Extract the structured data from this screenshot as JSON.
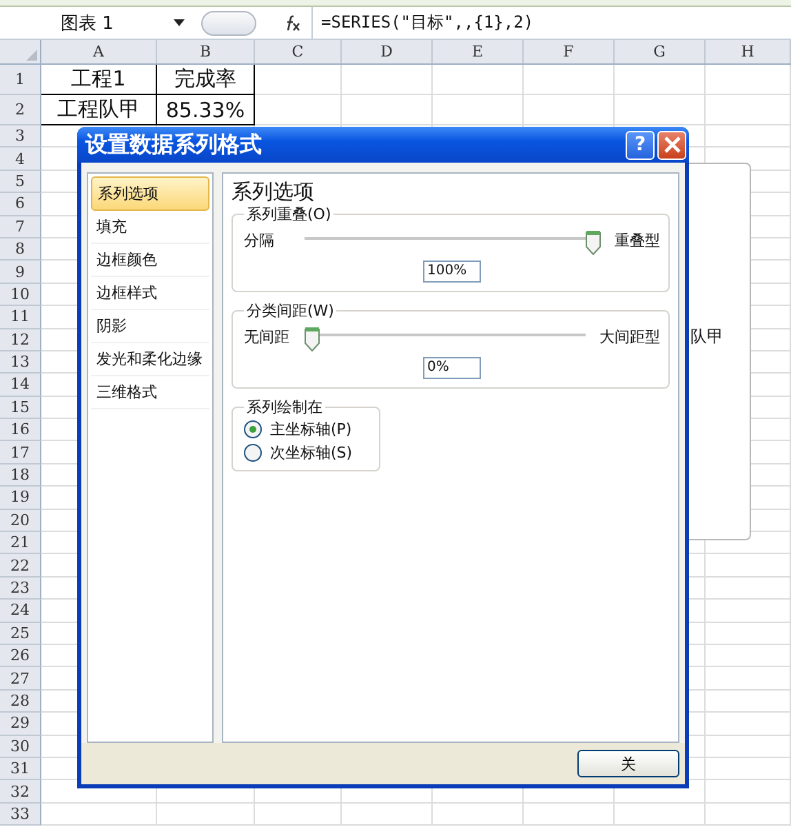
{
  "name_box": "图表 1",
  "formula": "=SERIES(\"目标\",,{1},2)",
  "columns": [
    "A",
    "B",
    "C",
    "D",
    "E",
    "F",
    "G",
    "H"
  ],
  "rows": [
    {
      "label": "1",
      "cells": [
        "工程1",
        "完成率"
      ]
    },
    {
      "label": "2",
      "cells": [
        "工程队甲",
        "85.33%"
      ]
    },
    {
      "label": "3"
    },
    {
      "label": "4"
    },
    {
      "label": "5"
    },
    {
      "label": "6"
    },
    {
      "label": "7"
    },
    {
      "label": "8"
    },
    {
      "label": "9"
    },
    {
      "label": "10"
    },
    {
      "label": "11"
    },
    {
      "label": "12"
    },
    {
      "label": "13"
    },
    {
      "label": "14"
    },
    {
      "label": "15"
    },
    {
      "label": "16"
    },
    {
      "label": "17"
    },
    {
      "label": "18"
    },
    {
      "label": "19"
    },
    {
      "label": "20"
    },
    {
      "label": "21"
    },
    {
      "label": "22"
    },
    {
      "label": "23"
    },
    {
      "label": "24"
    },
    {
      "label": "25"
    },
    {
      "label": "26"
    },
    {
      "label": "27"
    },
    {
      "label": "28"
    },
    {
      "label": "29"
    },
    {
      "label": "30"
    },
    {
      "label": "31"
    },
    {
      "label": "32"
    },
    {
      "label": "33"
    }
  ],
  "chart": {
    "text": "队甲"
  },
  "dialog": {
    "title": "设置数据系列格式",
    "help": "?",
    "nav": [
      {
        "label": "系列选项",
        "selected": true
      },
      {
        "label": "填充",
        "selected": false
      },
      {
        "label": "边框颜色",
        "selected": false
      },
      {
        "label": "边框样式",
        "selected": false
      },
      {
        "label": "阴影",
        "selected": false
      },
      {
        "label": "发光和柔化边缘",
        "selected": false
      },
      {
        "label": "三维格式",
        "selected": false
      }
    ],
    "section_title": "系列选项",
    "groups": [
      {
        "kind": "slider",
        "title": "系列重叠(O)",
        "left": "分隔",
        "right": "重叠型",
        "level": 1,
        "value": "100%"
      },
      {
        "kind": "slider",
        "title": "分类间距(W)",
        "left": "无间距",
        "right": "大间距型",
        "level": 0,
        "value": "0%"
      },
      {
        "kind": "radio",
        "title": "系列绘制在",
        "options": [
          {
            "label": "主坐标轴(P)",
            "selected": true
          },
          {
            "label": "次坐标轴(S)",
            "selected": false
          }
        ]
      }
    ],
    "button": "关"
  }
}
